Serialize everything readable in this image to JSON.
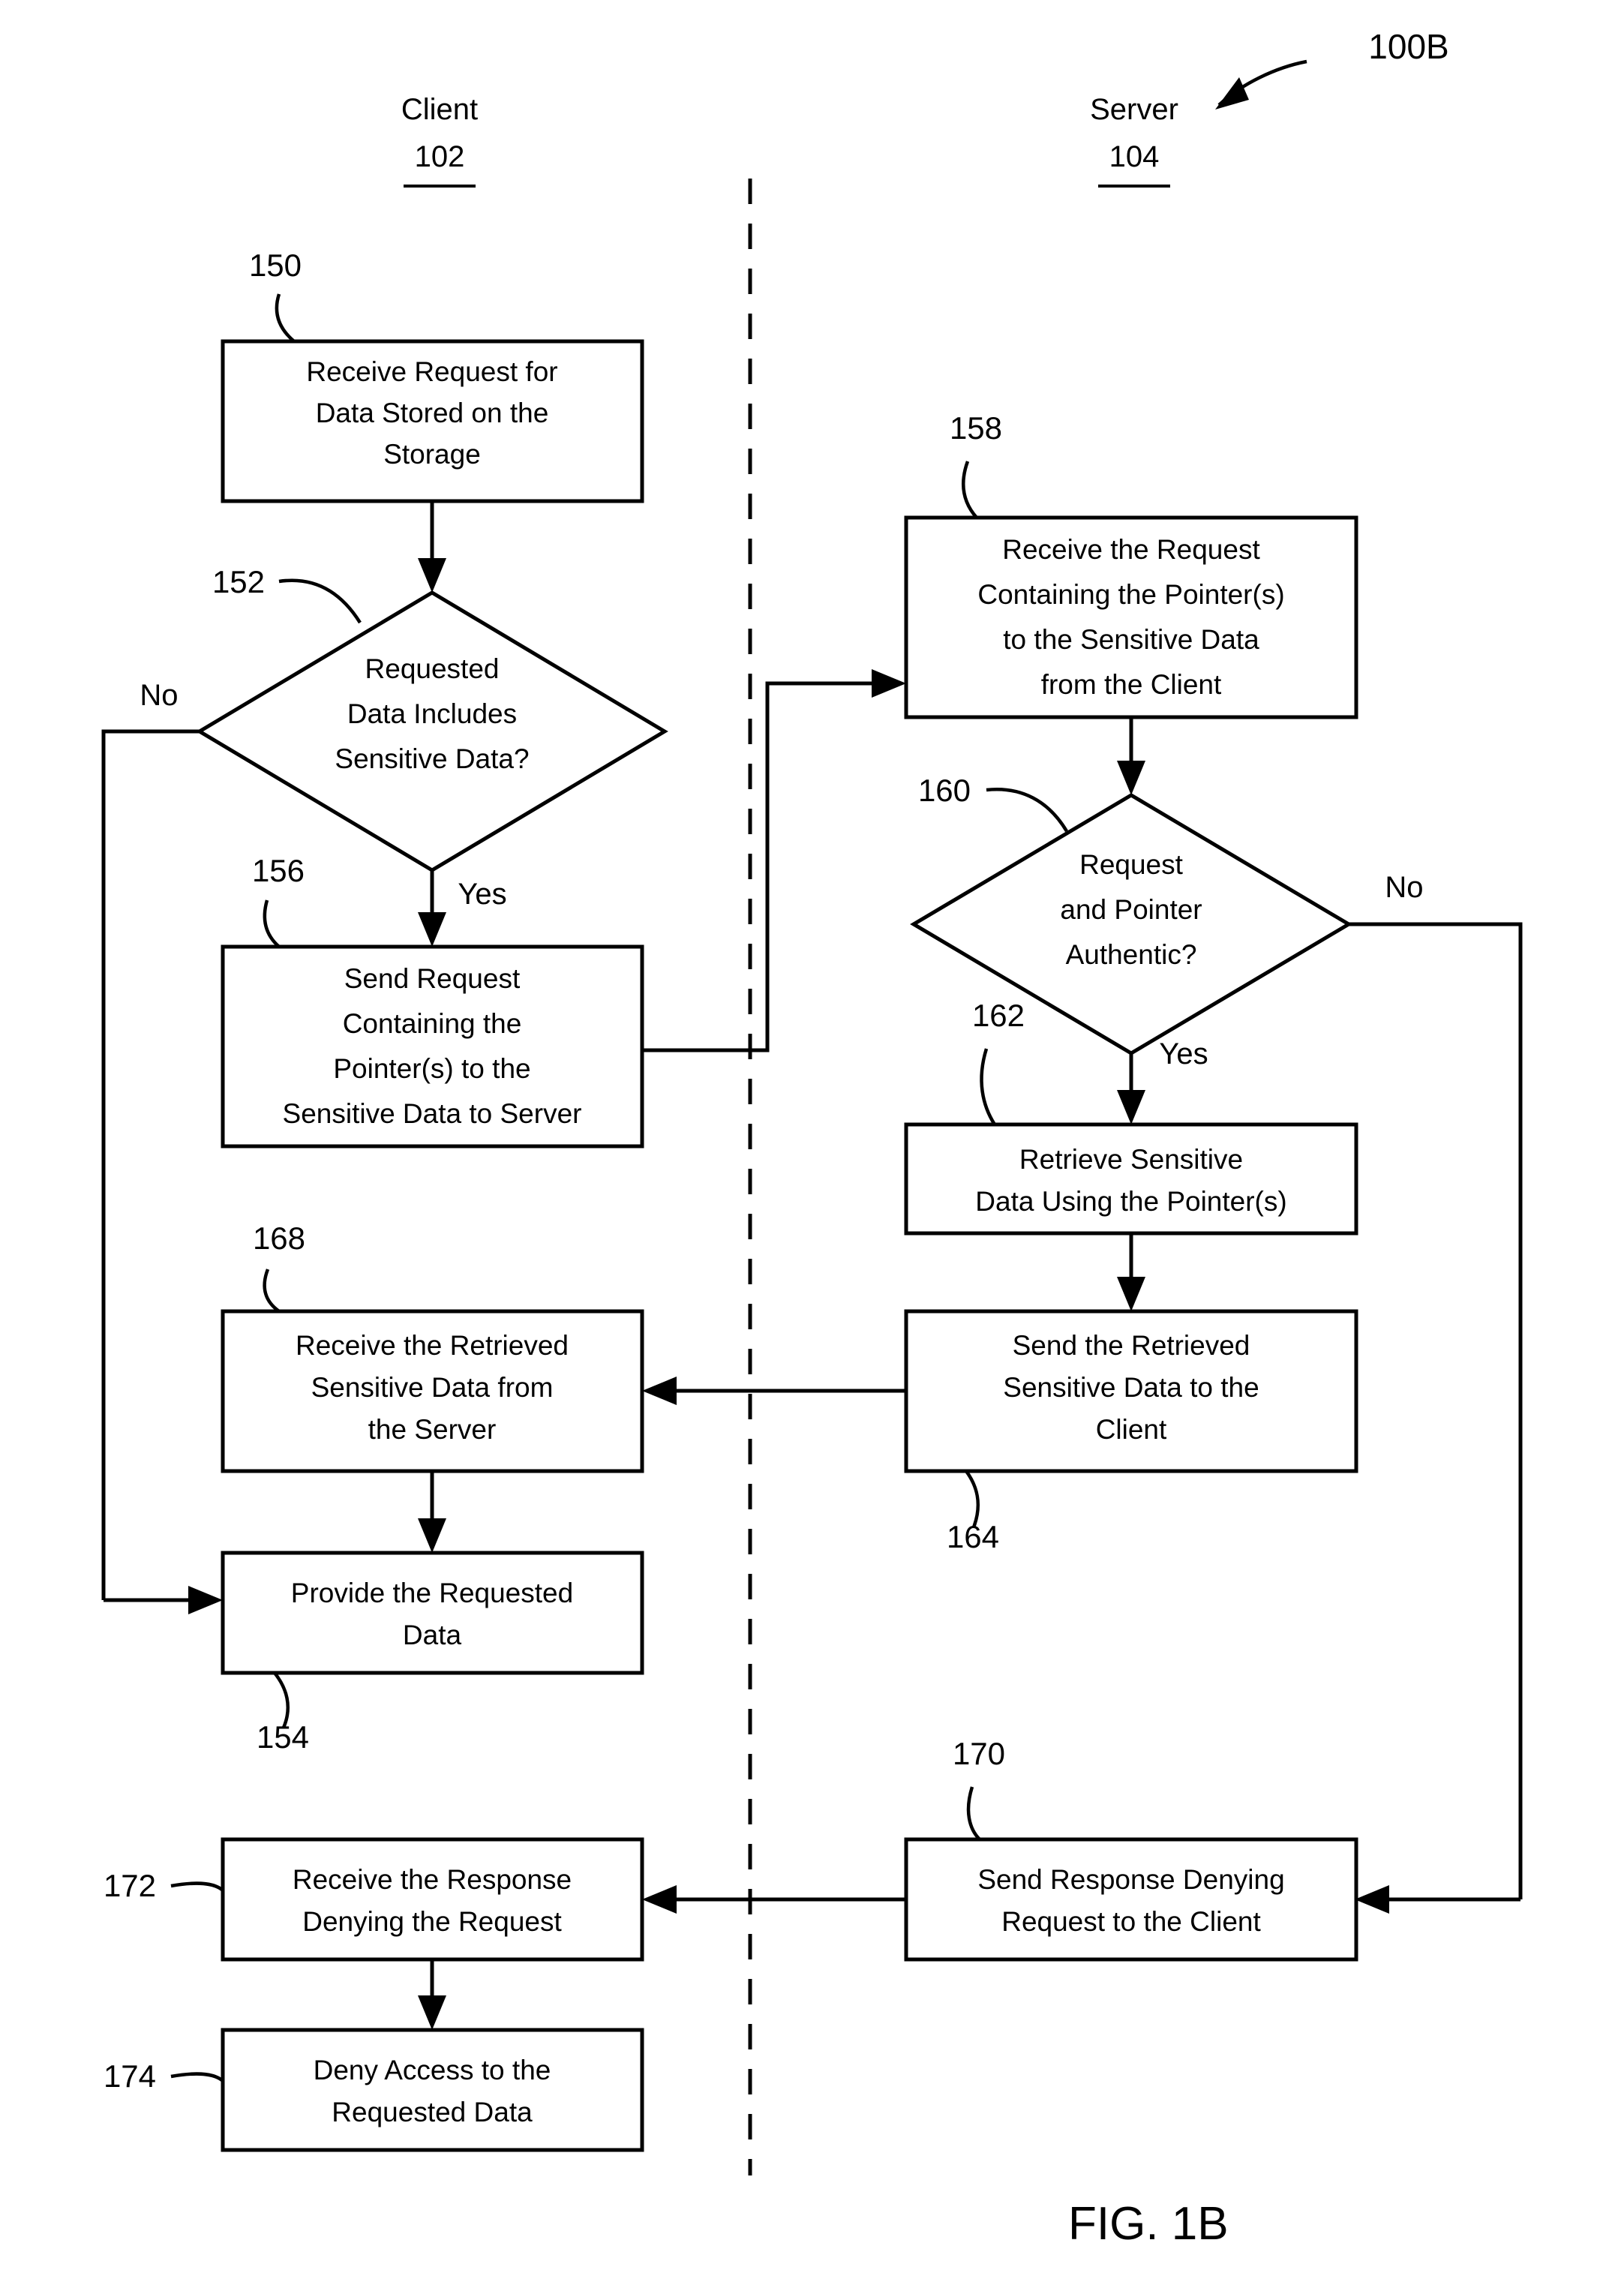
{
  "figure": {
    "id_label": "100B",
    "caption": "FIG. 1B"
  },
  "lanes": [
    {
      "title": "Client",
      "number": "102"
    },
    {
      "title": "Server",
      "number": "104"
    }
  ],
  "nodes": [
    {
      "ref": "150",
      "lane": "client",
      "shape": "process",
      "lines": [
        "Receive Request for",
        "Data Stored on the",
        "Storage"
      ]
    },
    {
      "ref": "152",
      "lane": "client",
      "shape": "decision",
      "lines": [
        "Requested",
        "Data Includes",
        "Sensitive Data?"
      ]
    },
    {
      "ref": "156",
      "lane": "client",
      "shape": "process",
      "lines": [
        "Send Request",
        "Containing the",
        "Pointer(s) to the",
        "Sensitive Data to Server"
      ]
    },
    {
      "ref": "158",
      "lane": "server",
      "shape": "process",
      "lines": [
        "Receive the Request",
        "Containing the Pointer(s)",
        "to the Sensitive Data",
        "from the Client"
      ]
    },
    {
      "ref": "160",
      "lane": "server",
      "shape": "decision",
      "lines": [
        "Request",
        "and Pointer",
        "Authentic?"
      ]
    },
    {
      "ref": "162",
      "lane": "server",
      "shape": "process",
      "lines": [
        "Retrieve Sensitive",
        "Data Using the Pointer(s)"
      ]
    },
    {
      "ref": "164",
      "lane": "server",
      "shape": "process",
      "lines": [
        "Send the Retrieved",
        "Sensitive Data to the",
        "Client"
      ]
    },
    {
      "ref": "168",
      "lane": "client",
      "shape": "process",
      "lines": [
        "Receive the Retrieved",
        "Sensitive Data from",
        "the Server"
      ]
    },
    {
      "ref": "154",
      "lane": "client",
      "shape": "process",
      "lines": [
        "Provide the Requested",
        "Data"
      ]
    },
    {
      "ref": "170",
      "lane": "server",
      "shape": "process",
      "lines": [
        "Send Response Denying",
        "Request to the Client"
      ]
    },
    {
      "ref": "172",
      "lane": "client",
      "shape": "process",
      "lines": [
        "Receive the Response",
        "Denying the Request"
      ]
    },
    {
      "ref": "174",
      "lane": "client",
      "shape": "process",
      "lines": [
        "Deny Access to the",
        "Requested Data"
      ]
    }
  ],
  "edge_labels": {
    "d152_no": "No",
    "d152_yes": "Yes",
    "d160_no": "No",
    "d160_yes": "Yes"
  },
  "text": {
    "n150_l1": "Receive Request for",
    "n150_l2": "Data Stored on the",
    "n150_l3": "Storage",
    "n152_l1": "Requested",
    "n152_l2": "Data Includes",
    "n152_l3": "Sensitive Data?",
    "n156_l1": "Send Request",
    "n156_l2": "Containing the",
    "n156_l3": "Pointer(s) to the",
    "n156_l4": "Sensitive Data to Server",
    "n158_l1": "Receive the Request",
    "n158_l2": "Containing the Pointer(s)",
    "n158_l3": "to the Sensitive Data",
    "n158_l4": "from the Client",
    "n160_l1": "Request",
    "n160_l2": "and Pointer",
    "n160_l3": "Authentic?",
    "n162_l1": "Retrieve Sensitive",
    "n162_l2": "Data Using the Pointer(s)",
    "n164_l1": "Send the Retrieved",
    "n164_l2": "Sensitive Data to the",
    "n164_l3": "Client",
    "n168_l1": "Receive the Retrieved",
    "n168_l2": "Sensitive Data from",
    "n168_l3": "the Server",
    "n154_l1": "Provide the Requested",
    "n154_l2": "Data",
    "n170_l1": "Send Response Denying",
    "n170_l2": "Request to the Client",
    "n172_l1": "Receive the Response",
    "n172_l2": "Denying the Request",
    "n174_l1": "Deny Access to the",
    "n174_l2": "Requested Data"
  },
  "ref_numbers": {
    "r150": "150",
    "r152": "152",
    "r154": "154",
    "r156": "156",
    "r158": "158",
    "r160": "160",
    "r162": "162",
    "r164": "164",
    "r168": "168",
    "r170": "170",
    "r172": "172",
    "r174": "174"
  },
  "colors": {
    "ink": "#000000",
    "paper": "#ffffff"
  }
}
